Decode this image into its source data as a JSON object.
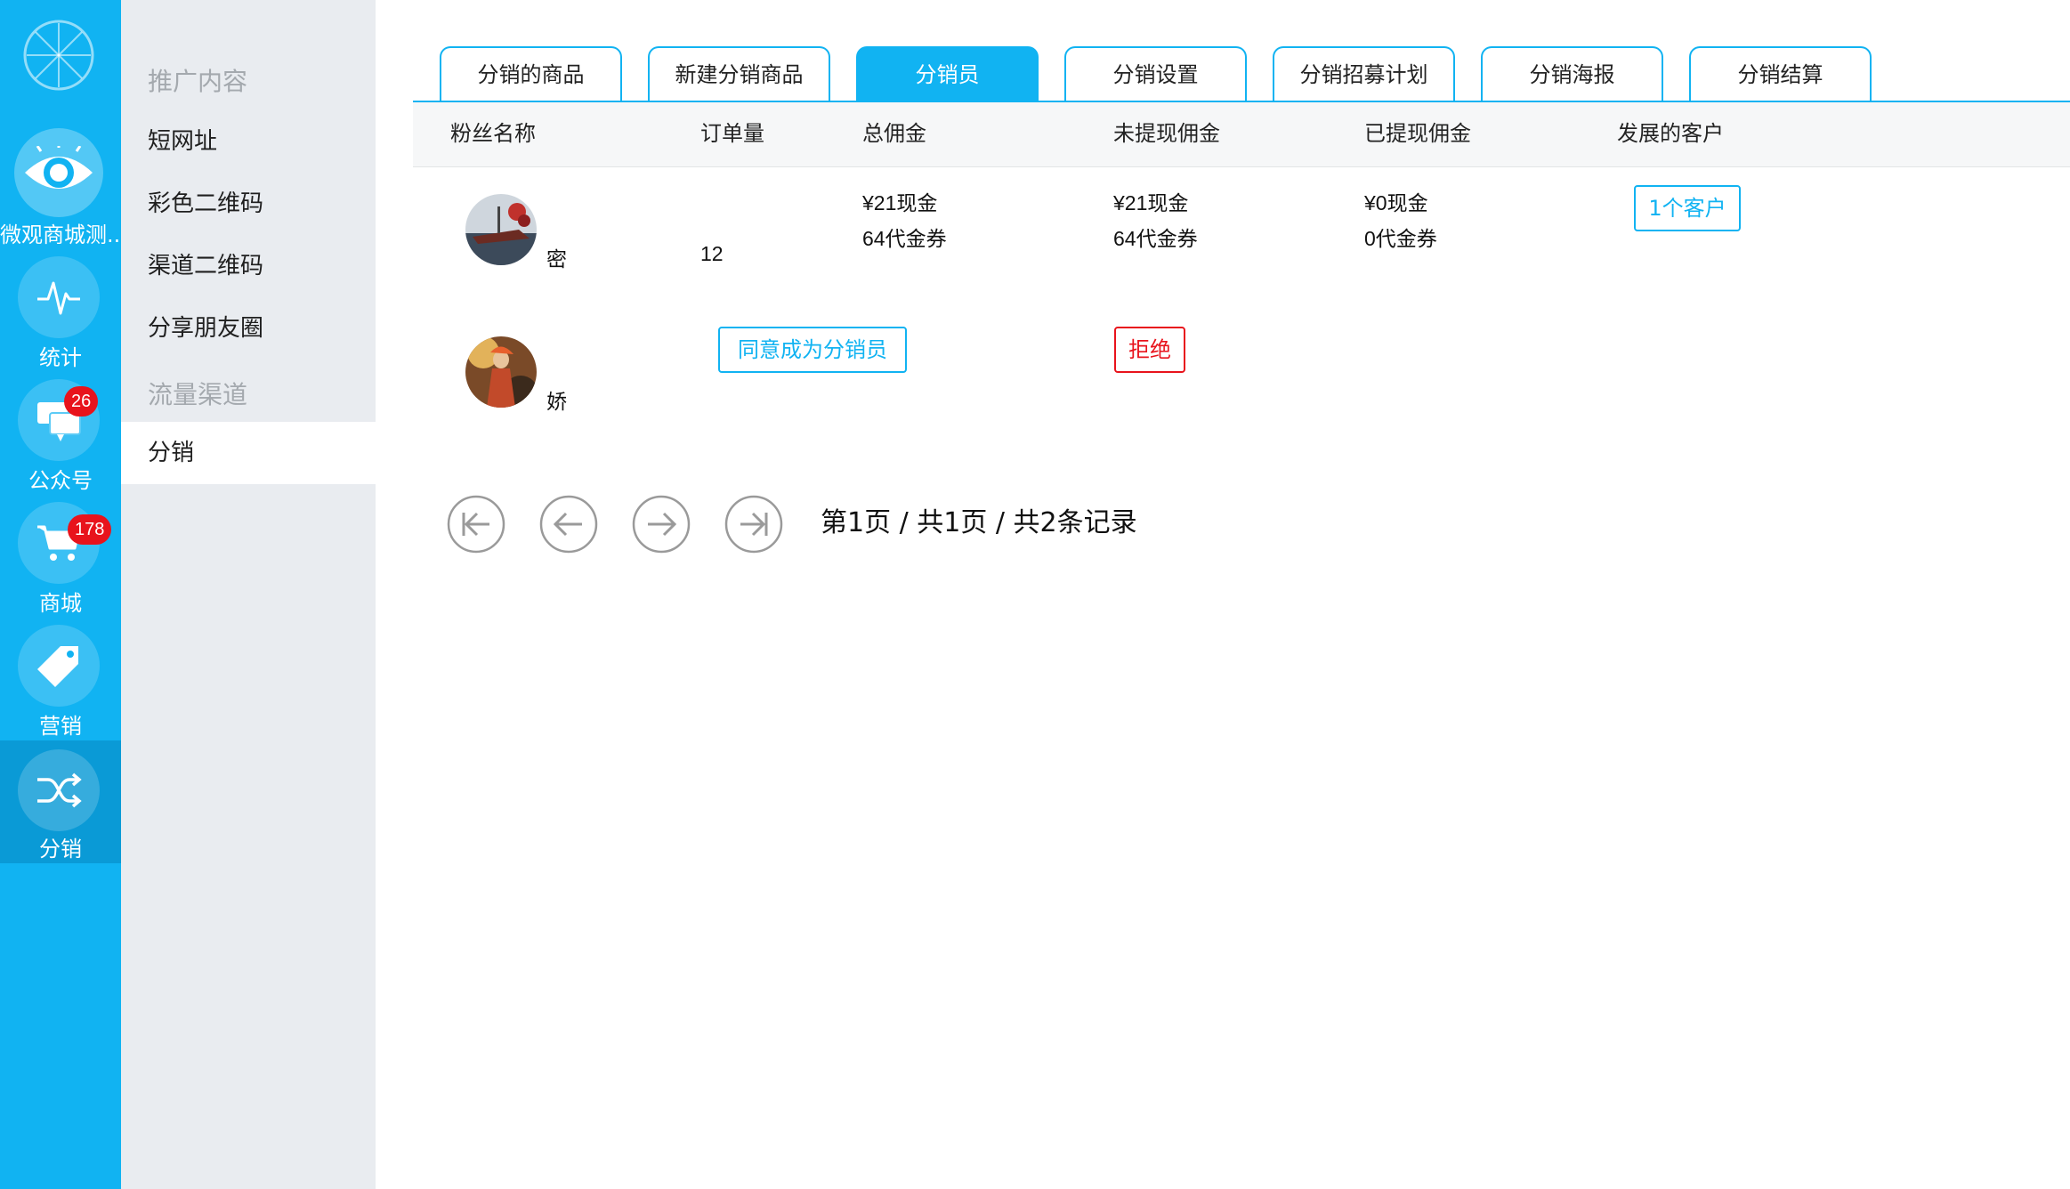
{
  "colors": {
    "accent": "#11b3f2",
    "danger": "#e8131c",
    "nav_bg": "#e9ecf0"
  },
  "rail": {
    "logo_icon": "wheel-logo-icon",
    "items": [
      {
        "label": "微观商城测...",
        "icon": "eye-icon"
      },
      {
        "label": "统计",
        "icon": "pulse-icon"
      },
      {
        "label": "公众号",
        "icon": "chat-icon",
        "badge": "26"
      },
      {
        "label": "商城",
        "icon": "cart-icon",
        "badge": "178"
      },
      {
        "label": "营销",
        "icon": "tag-icon"
      },
      {
        "label": "分销",
        "icon": "shuffle-icon"
      }
    ]
  },
  "subnav": {
    "heading1": "推广内容",
    "items1": [
      "短网址",
      "彩色二维码",
      "渠道二维码",
      "分享朋友圈"
    ],
    "heading2": "流量渠道",
    "items2": [
      "分销"
    ]
  },
  "tabs": [
    "分销的商品",
    "新建分销商品",
    "分销员",
    "分销设置",
    "分销招募计划",
    "分销海报",
    "分销结算"
  ],
  "table": {
    "headers": [
      "粉丝名称",
      "订单量",
      "总佣金",
      "未提现佣金",
      "已提现佣金",
      "发展的客户"
    ],
    "row1": {
      "name": "密",
      "orders": "12",
      "total": [
        "¥21现金",
        "64代金券"
      ],
      "unwithdrawn": [
        "¥21现金",
        "64代金券"
      ],
      "withdrawn": [
        "¥0现金",
        "0代金券"
      ],
      "customers": "1个客户"
    },
    "row2": {
      "name": "娇",
      "approve": "同意成为分销员",
      "reject": "拒绝"
    }
  },
  "pagination": {
    "text": "第1页 / 共1页 / 共2条记录"
  }
}
